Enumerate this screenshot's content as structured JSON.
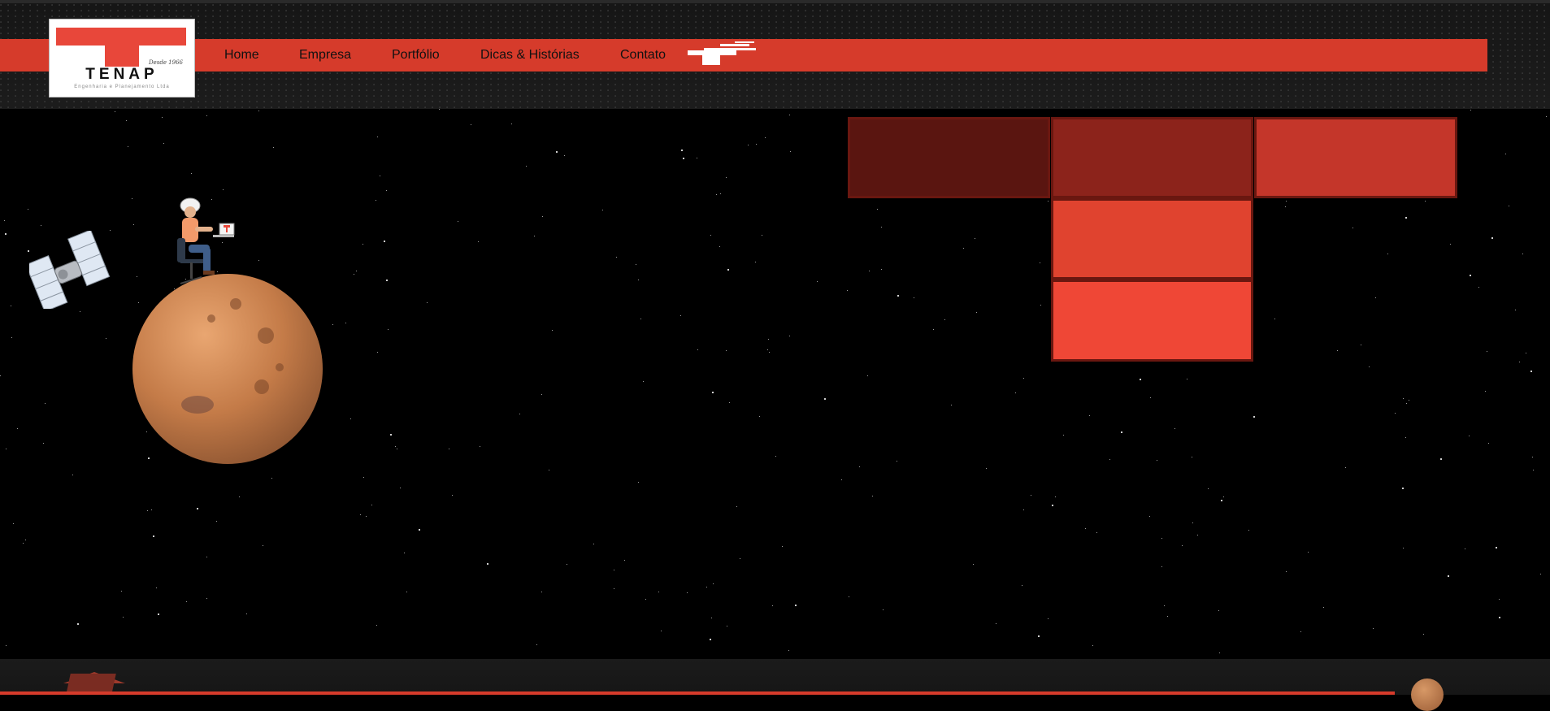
{
  "logo": {
    "word": "TENAP",
    "tagline": "Engenharia e Planejamento Ltda",
    "since": "Desde 1966",
    "brand_color": "#e8473a"
  },
  "nav": {
    "items": [
      {
        "label": "Home"
      },
      {
        "label": "Empresa"
      },
      {
        "label": "Portfólio"
      },
      {
        "label": "Dicas & Histórias"
      },
      {
        "label": "Contato"
      }
    ]
  },
  "icons": {
    "nav_plane": "airplane-icon",
    "satellite": "satellite-icon",
    "planet": "mars-planet",
    "worker": "engineer-with-laptop"
  },
  "tiles": {
    "colors": [
      "#5a1510",
      "#8c231b",
      "#c4362a",
      "#e0432f",
      "#ef4736"
    ]
  },
  "colors": {
    "accent": "#d63b2b",
    "background": "#000000",
    "header": "#181818"
  }
}
